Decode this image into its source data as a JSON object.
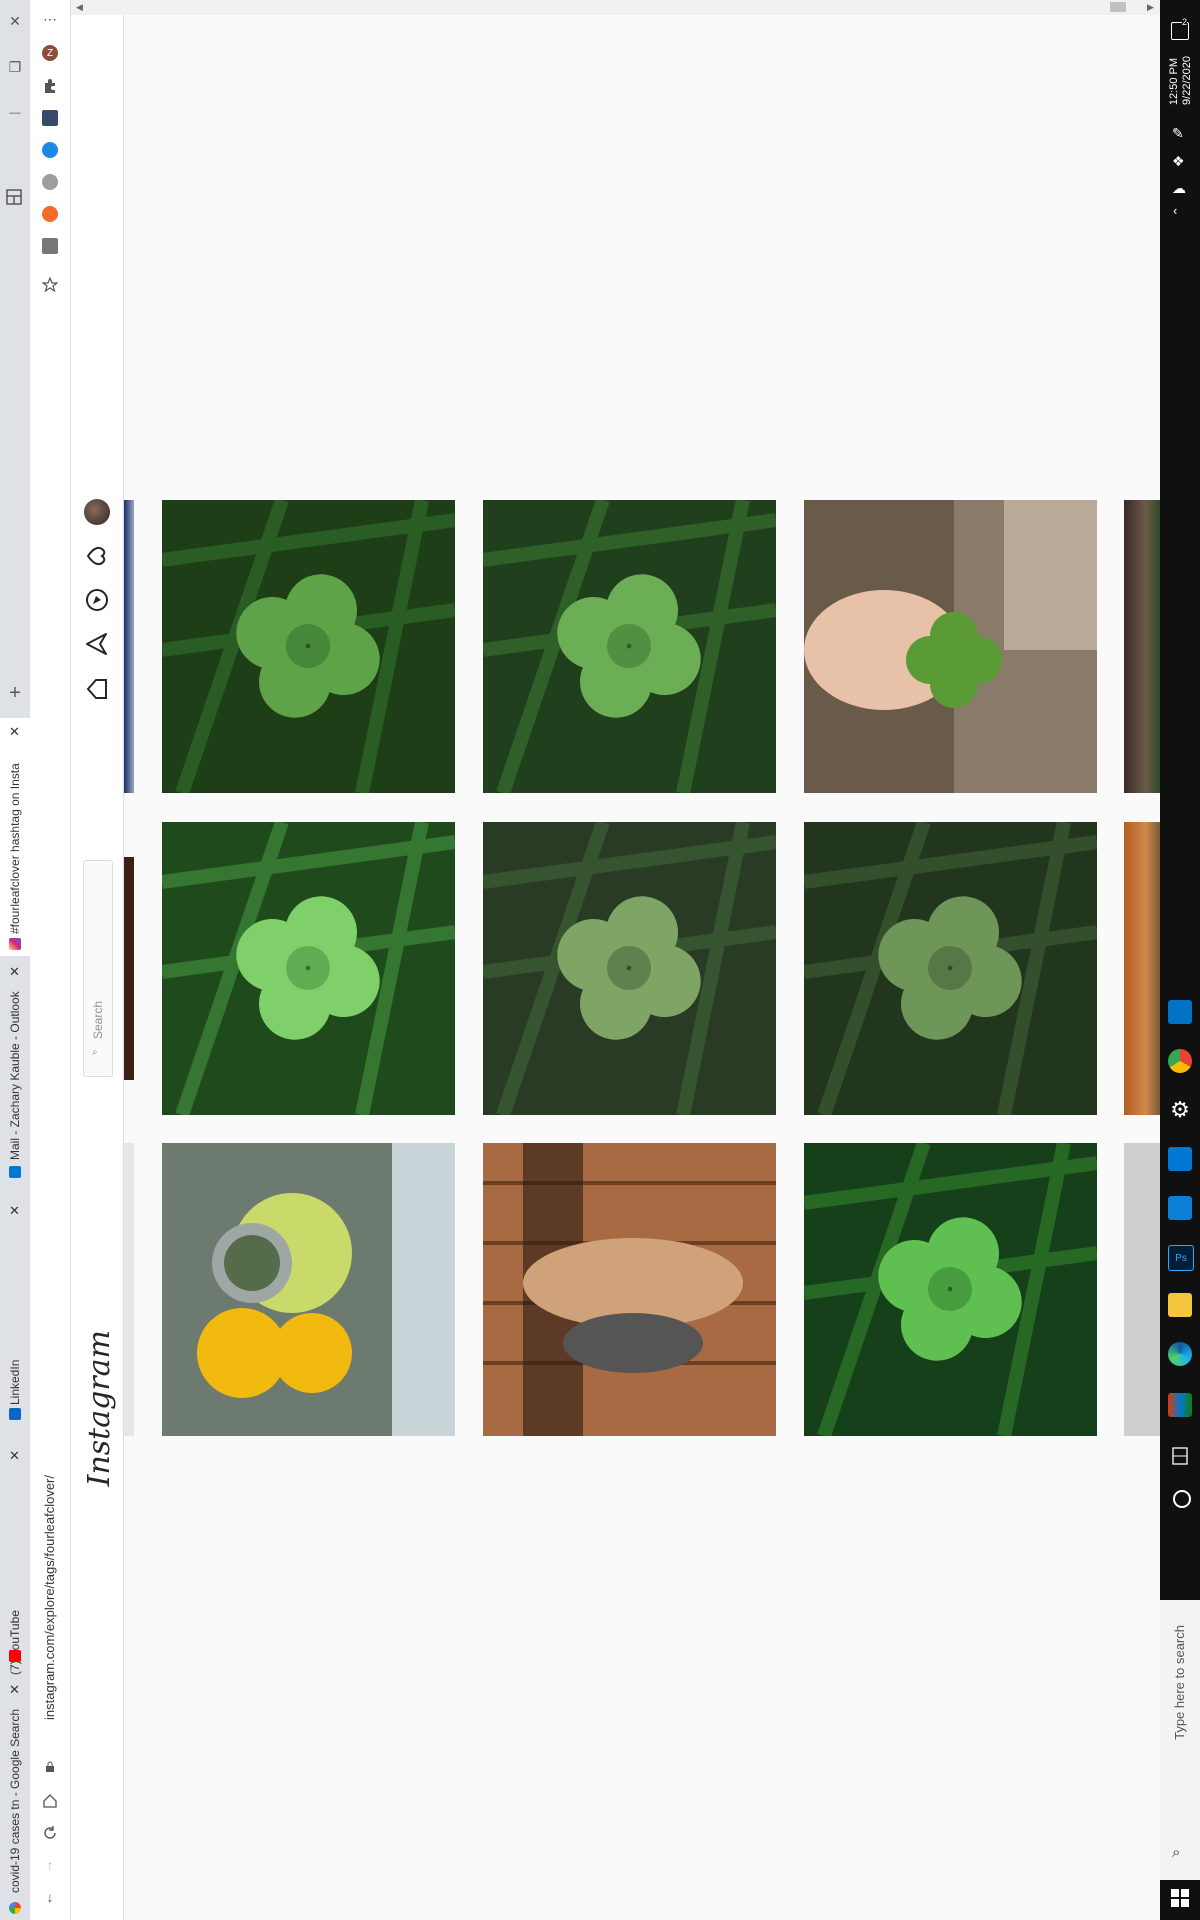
{
  "browser": {
    "tabs": [
      {
        "label": "covid-19 cases tn - Google Search",
        "favicon": "google-icon",
        "color": "#4285f4"
      },
      {
        "label": "(7) YouTube",
        "favicon": "youtube-icon",
        "color": "#ff0000"
      },
      {
        "label": "LinkedIn",
        "favicon": "linkedin-icon",
        "color": "#0a66c2"
      },
      {
        "label": "Mail - Zachary Kauble - Outlook",
        "favicon": "outlook-icon",
        "color": "#0078d4"
      },
      {
        "label": "#fourleafclover hashtag on Insta",
        "favicon": "instagram-icon",
        "color": "#e1306c",
        "active": true
      }
    ],
    "address": "instagram.com/explore/tags/fourleafclover/",
    "new_tab": "+",
    "close_glyph": "✕",
    "window_controls": {
      "close": "✕",
      "restore": "❐",
      "minimize": "—"
    },
    "menu_glyph": "⋯",
    "profile_initial": "Z"
  },
  "instagram": {
    "logo": "Instagram",
    "search_placeholder": "Search",
    "nav_icons": [
      "home-icon",
      "direct-icon",
      "explore-icon",
      "activity-icon",
      "profile-avatar"
    ],
    "tiles": [
      {
        "scene": "clover",
        "colors": [
          "#2f6b2a",
          "#5fa348",
          "#1d3e17"
        ]
      },
      {
        "scene": "clover",
        "colors": [
          "#3f8a3a",
          "#7fd06a",
          "#1f4a1c"
        ]
      },
      {
        "scene": "flowers",
        "colors": [
          "#f2b90f",
          "#c9d96a",
          "#6d7a6f"
        ]
      },
      {
        "scene": "clover",
        "colors": [
          "#356f2d",
          "#6cae55",
          "#203f1c"
        ]
      },
      {
        "scene": "clover",
        "colors": [
          "#3d5f35",
          "#7ea566",
          "#2a3b25"
        ]
      },
      {
        "scene": "portrait",
        "colors": [
          "#a86a43",
          "#6b3f22",
          "#cfa27a"
        ]
      },
      {
        "scene": "hand",
        "colors": [
          "#8a7a6a",
          "#5a9b35",
          "#e7c2a8"
        ]
      },
      {
        "scene": "clover",
        "colors": [
          "#3b5a33",
          "#6f9659",
          "#22361e"
        ]
      },
      {
        "scene": "clover",
        "colors": [
          "#2f7a2a",
          "#5fbf50",
          "#15401a"
        ]
      }
    ]
  },
  "taskbar": {
    "time": "12:50 PM",
    "date": "9/22/2020",
    "search_placeholder": "Type here to search",
    "pinned": [
      "task-view-icon",
      "cortana-icon",
      "office-icon",
      "edge-icon",
      "file-explorer-icon",
      "photoshop-icon",
      "vscode-icon",
      "outlook-icon",
      "settings-icon",
      "chrome-icon",
      "mail-app-icon"
    ],
    "notification_count": "2"
  }
}
